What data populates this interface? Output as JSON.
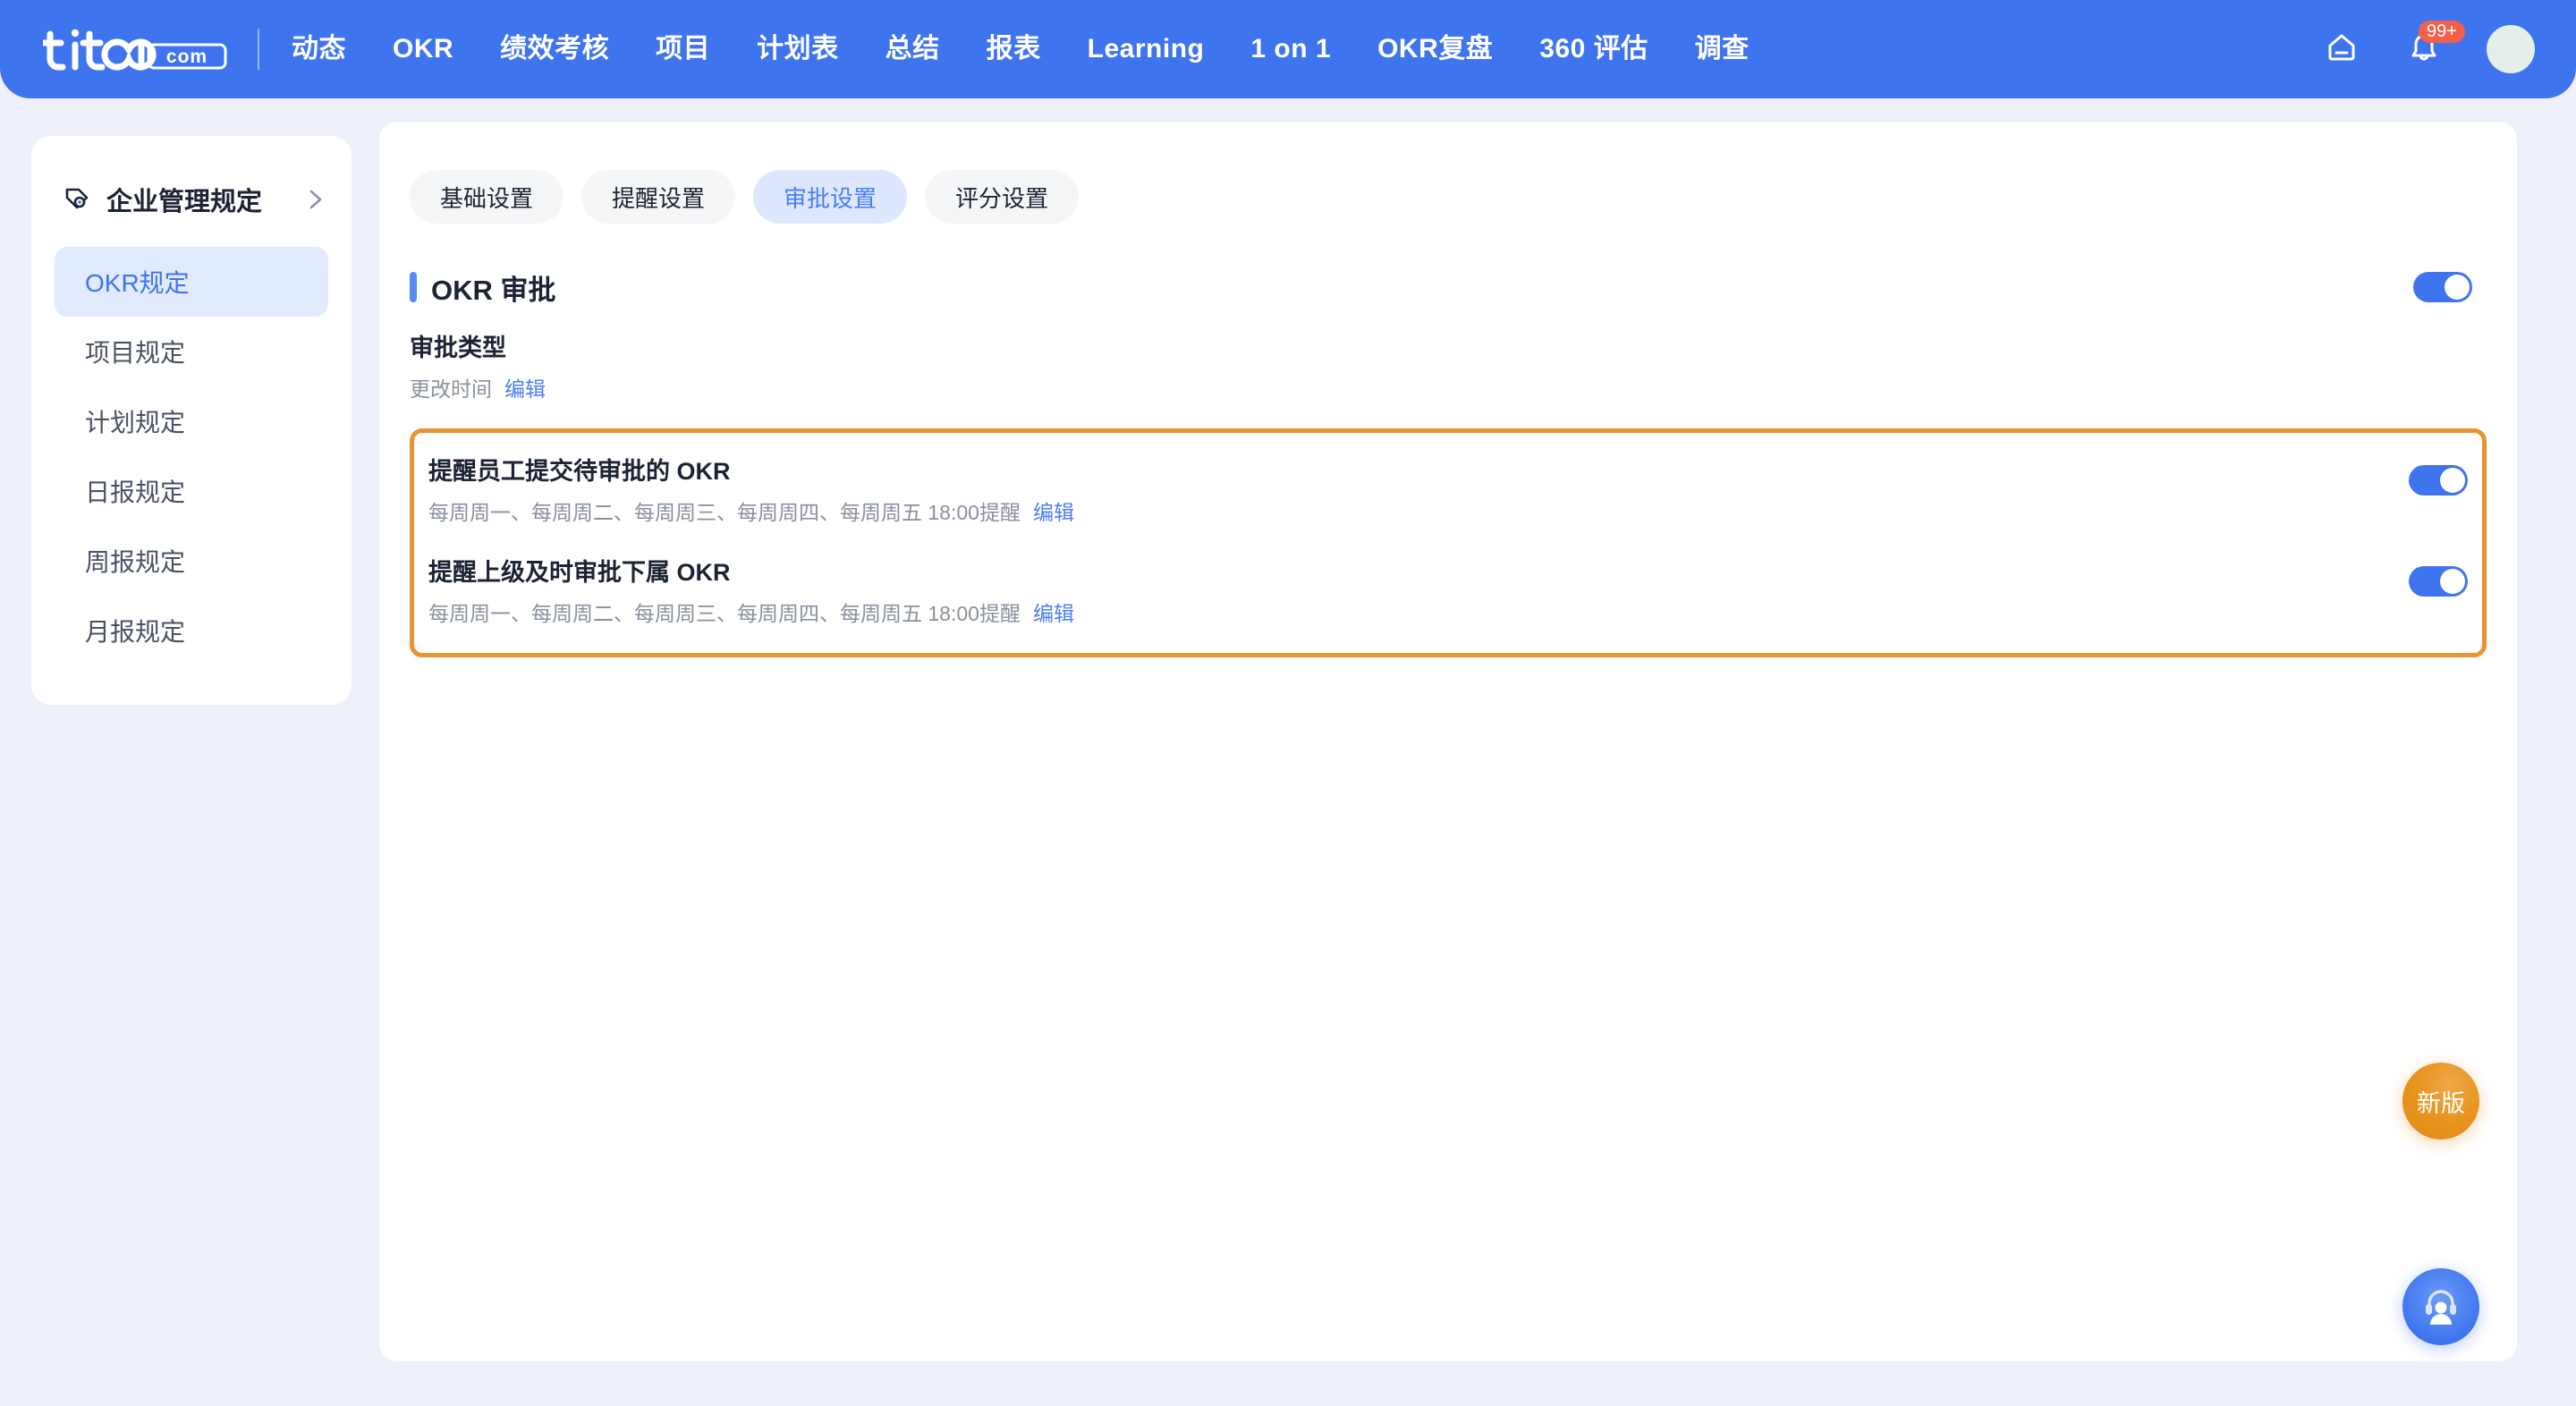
{
  "brand": {
    "name": "tita",
    "suffix": ".com"
  },
  "topnav": {
    "items": [
      {
        "label": "动态",
        "name": "nav-item-dongtai"
      },
      {
        "label": "OKR",
        "name": "nav-item-okr"
      },
      {
        "label": "绩效考核",
        "name": "nav-item-performance"
      },
      {
        "label": "项目",
        "name": "nav-item-project"
      },
      {
        "label": "计划表",
        "name": "nav-item-plan"
      },
      {
        "label": "总结",
        "name": "nav-item-summary"
      },
      {
        "label": "报表",
        "name": "nav-item-report"
      },
      {
        "label": "Learning",
        "name": "nav-item-learning"
      },
      {
        "label": "1 on 1",
        "name": "nav-item-1on1"
      },
      {
        "label": "OKR复盘",
        "name": "nav-item-okr-review"
      },
      {
        "label": "360 评估",
        "name": "nav-item-360"
      },
      {
        "label": "调查",
        "name": "nav-item-survey"
      }
    ],
    "home_icon": "home-icon",
    "notification_icon": "bell-icon",
    "notification_badge": "99+",
    "avatar": "avatar"
  },
  "sidebar": {
    "title": "企业管理规定",
    "title_icon": "tag-icon",
    "expand_icon": "chevron-right-icon",
    "items": [
      {
        "label": "OKR规定",
        "active": true
      },
      {
        "label": "项目规定",
        "active": false
      },
      {
        "label": "计划规定",
        "active": false
      },
      {
        "label": "日报规定",
        "active": false
      },
      {
        "label": "周报规定",
        "active": false
      },
      {
        "label": "月报规定",
        "active": false
      }
    ]
  },
  "main": {
    "tabs": [
      {
        "label": "基础设置",
        "active": false
      },
      {
        "label": "提醒设置",
        "active": false
      },
      {
        "label": "审批设置",
        "active": true
      },
      {
        "label": "评分设置",
        "active": false
      }
    ],
    "section": {
      "title": "OKR 审批",
      "enabled": true,
      "toggle_state": "on"
    },
    "rows": [
      {
        "title": "审批类型",
        "subtitle": "更改时间",
        "edit_label": "编辑",
        "has_toggle": false
      }
    ],
    "highlighted_rows": [
      {
        "title": "提醒员工提交待审批的 OKR",
        "subtitle": "每周周一、每周周二、每周周三、每周周四、每周周五 18:00提醒",
        "edit_label": "编辑",
        "has_toggle": true,
        "toggle_state": "on"
      },
      {
        "title": "提醒上级及时审批下属 OKR",
        "subtitle": "每周周一、每周周二、每周周三、每周周四、每周周五 18:00提醒",
        "edit_label": "编辑",
        "has_toggle": true,
        "toggle_state": "on"
      }
    ],
    "highlight_color": "#e8942f"
  },
  "floating": {
    "new_version_label": "新版",
    "support_icon": "headset-support-icon"
  },
  "colors": {
    "brand_blue": "#3f74ef",
    "accent_link": "#4a7ef2",
    "page_bg": "#eef1fa",
    "highlight_orange": "#e8942f",
    "badge_red": "#f4604a"
  }
}
